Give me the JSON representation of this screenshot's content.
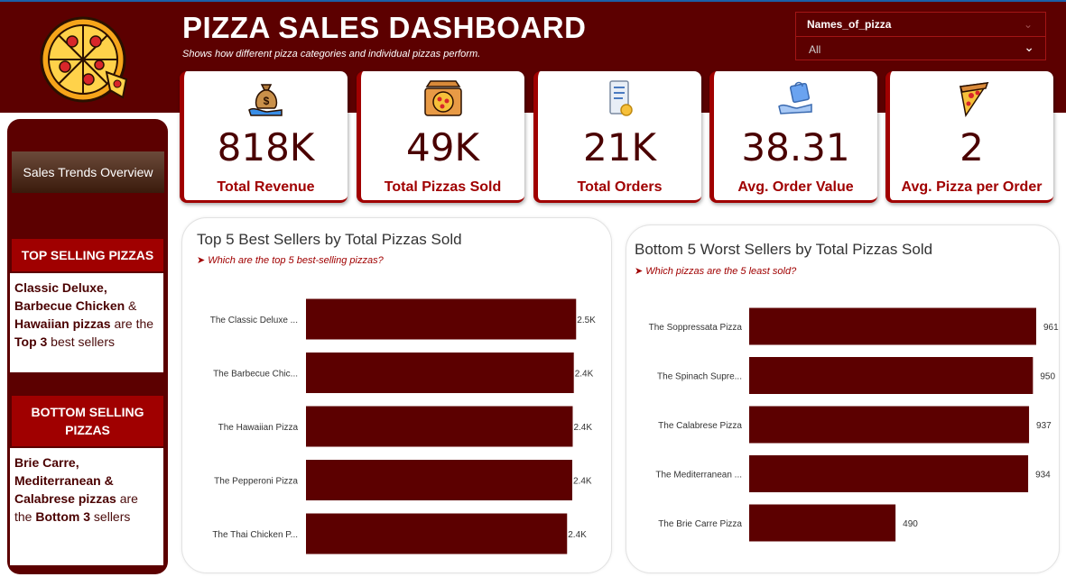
{
  "header": {
    "title": "PIZZA SALES DASHBOARD",
    "subtitle": "Shows how different pizza categories and individual pizzas perform."
  },
  "slicer": {
    "label": "Names_of_pizza",
    "value": "All"
  },
  "sidebar": {
    "trend_button": "Sales Trends Overview",
    "top_heading": "TOP SELLING PIZZAS",
    "bottom_heading": "BOTTOM SELLING PIZZAS",
    "top_text": {
      "p1": "Classic Deluxe,",
      "p2": "Barbecue Chicken",
      "p3": " & ",
      "p4": "Hawaiian pizzas",
      "p5": " are the ",
      "p6": "Top 3",
      "p7": " best sellers"
    },
    "bottom_text": {
      "p1": "Brie Carre,",
      "p2": "Mediterranean &",
      "p3": "Calabrese pizzas",
      "p4": " are the ",
      "p5": "Bottom 3",
      "p6": " sellers"
    }
  },
  "kpis": [
    {
      "value": "818K",
      "label": "Total Revenue",
      "icon": "money-bag-icon"
    },
    {
      "value": "49K",
      "label": "Total Pizzas Sold",
      "icon": "pizza-box-icon"
    },
    {
      "value": "21K",
      "label": "Total Orders",
      "icon": "receipt-icon"
    },
    {
      "value": "38.31",
      "label": "Avg. Order Value",
      "icon": "shopping-bag-hand-icon"
    },
    {
      "value": "2",
      "label": "Avg. Pizza per Order",
      "icon": "pizza-slice-icon"
    }
  ],
  "colors": {
    "brand": "#5c0000",
    "accent": "#a00000",
    "bar": "#5c0000"
  },
  "chart_data": [
    {
      "type": "bar",
      "orientation": "horizontal",
      "title": "Top 5 Best Sellers by Total Pizzas Sold",
      "subtitle": "➤ Which are the top 5 best-selling pizzas?",
      "categories": [
        "The Classic Deluxe ...",
        "The Barbecue Chic...",
        "The Hawaiian Pizza",
        "The Pepperoni Pizza",
        "The Thai Chicken P..."
      ],
      "values": [
        2453,
        2432,
        2422,
        2418,
        2371
      ],
      "data_labels": [
        "2.5K",
        "2.4K",
        "2.4K",
        "2.4K",
        "2.4K"
      ],
      "xlim": [
        0,
        2500
      ]
    },
    {
      "type": "bar",
      "orientation": "horizontal",
      "title": "Bottom 5 Worst Sellers by Total Pizzas Sold",
      "subtitle": "➤ Which pizzas are the 5 least sold?",
      "categories": [
        "The Soppressata Pizza",
        "The Spinach Supre...",
        "The Calabrese Pizza",
        "The Mediterranean ...",
        "The Brie Carre Pizza"
      ],
      "values": [
        961,
        950,
        937,
        934,
        490
      ],
      "data_labels": [
        "961",
        "950",
        "937",
        "934",
        "490"
      ],
      "xlim": [
        0,
        961
      ]
    }
  ]
}
